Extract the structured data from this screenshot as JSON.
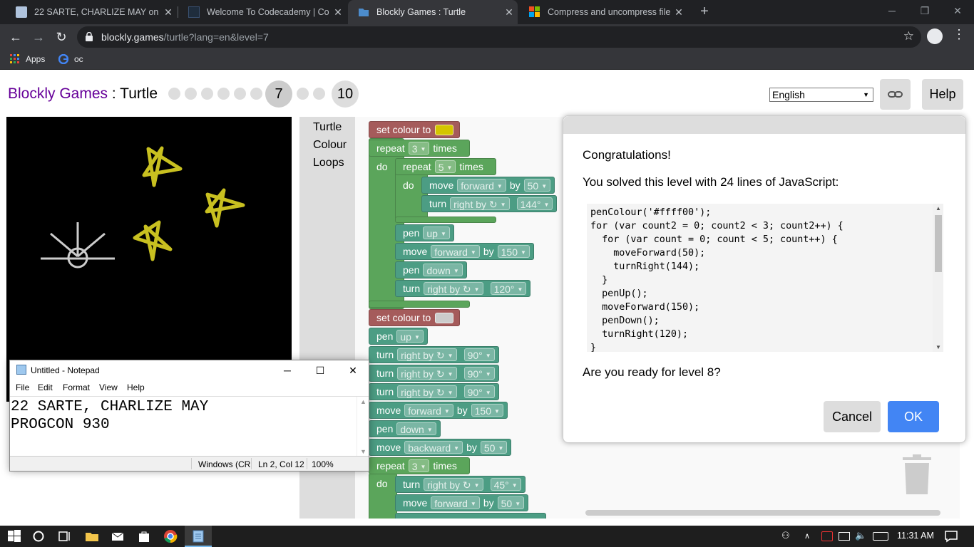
{
  "browser": {
    "tabs": [
      {
        "title": "22 SARTE, CHARLIZE MAY on 201",
        "close": "✕"
      },
      {
        "title": "Welcome To Codecademy | Code",
        "close": "✕"
      },
      {
        "title": "Blockly Games : Turtle",
        "close": "✕"
      },
      {
        "title": "Compress and uncompress files (",
        "close": "✕"
      }
    ],
    "new_tab": "+",
    "url_host": "blockly.games",
    "url_path": "/turtle?lang=en&level=7",
    "bookmarks": [
      {
        "label": "Apps"
      },
      {
        "label": "oc"
      }
    ]
  },
  "game": {
    "brand": "Blockly Games",
    "separator": " : ",
    "name": "Turtle",
    "current_level": "7",
    "last_level": "10",
    "language": "English",
    "help": "Help",
    "categories": [
      "Turtle",
      "Colour",
      "Loops"
    ]
  },
  "blocks": {
    "set_colour": "set colour to",
    "repeat": "repeat",
    "times": "times",
    "do": "do",
    "move": "move",
    "turn": "turn",
    "pen": "pen",
    "by": "by",
    "forward": "forward",
    "backward": "backward",
    "right_by": "right by ↻",
    "up": "up",
    "down": "down",
    "n3": "3",
    "n5": "5",
    "n50": "50",
    "n150": "150",
    "a144": "144°",
    "a120": "120°",
    "a90": "90°",
    "a45": "45°",
    "colour1": "#d4c500",
    "colour2": "#cccccc"
  },
  "dialog": {
    "title": "Congratulations!",
    "message": "You solved this level with 24 lines of JavaScript:",
    "question": "Are you ready for level 8?",
    "cancel": "Cancel",
    "ok": "OK",
    "code_lines": [
      "penColour('#ffff00');",
      "for (var count2 = 0; count2 < 3; count2++) {",
      "  for (var count = 0; count < 5; count++) {",
      "    moveForward(50);",
      "    turnRight(144);",
      "  }",
      "  penUp();",
      "  moveForward(150);",
      "  penDown();",
      "  turnRight(120);",
      "}"
    ]
  },
  "notepad": {
    "title": "Untitled - Notepad",
    "menu": [
      "File",
      "Edit",
      "Format",
      "View",
      "Help"
    ],
    "content": "22 SARTE, CHARLIZE MAY\nPROGCON 930",
    "status_encoding": "Windows (CR",
    "status_position": "Ln 2, Col 12",
    "status_zoom": "100%"
  },
  "taskbar": {
    "time": "11:31 AM"
  },
  "colors": {
    "brand": "#660099",
    "star": "#c8c020",
    "ok_button": "#4285f4"
  }
}
